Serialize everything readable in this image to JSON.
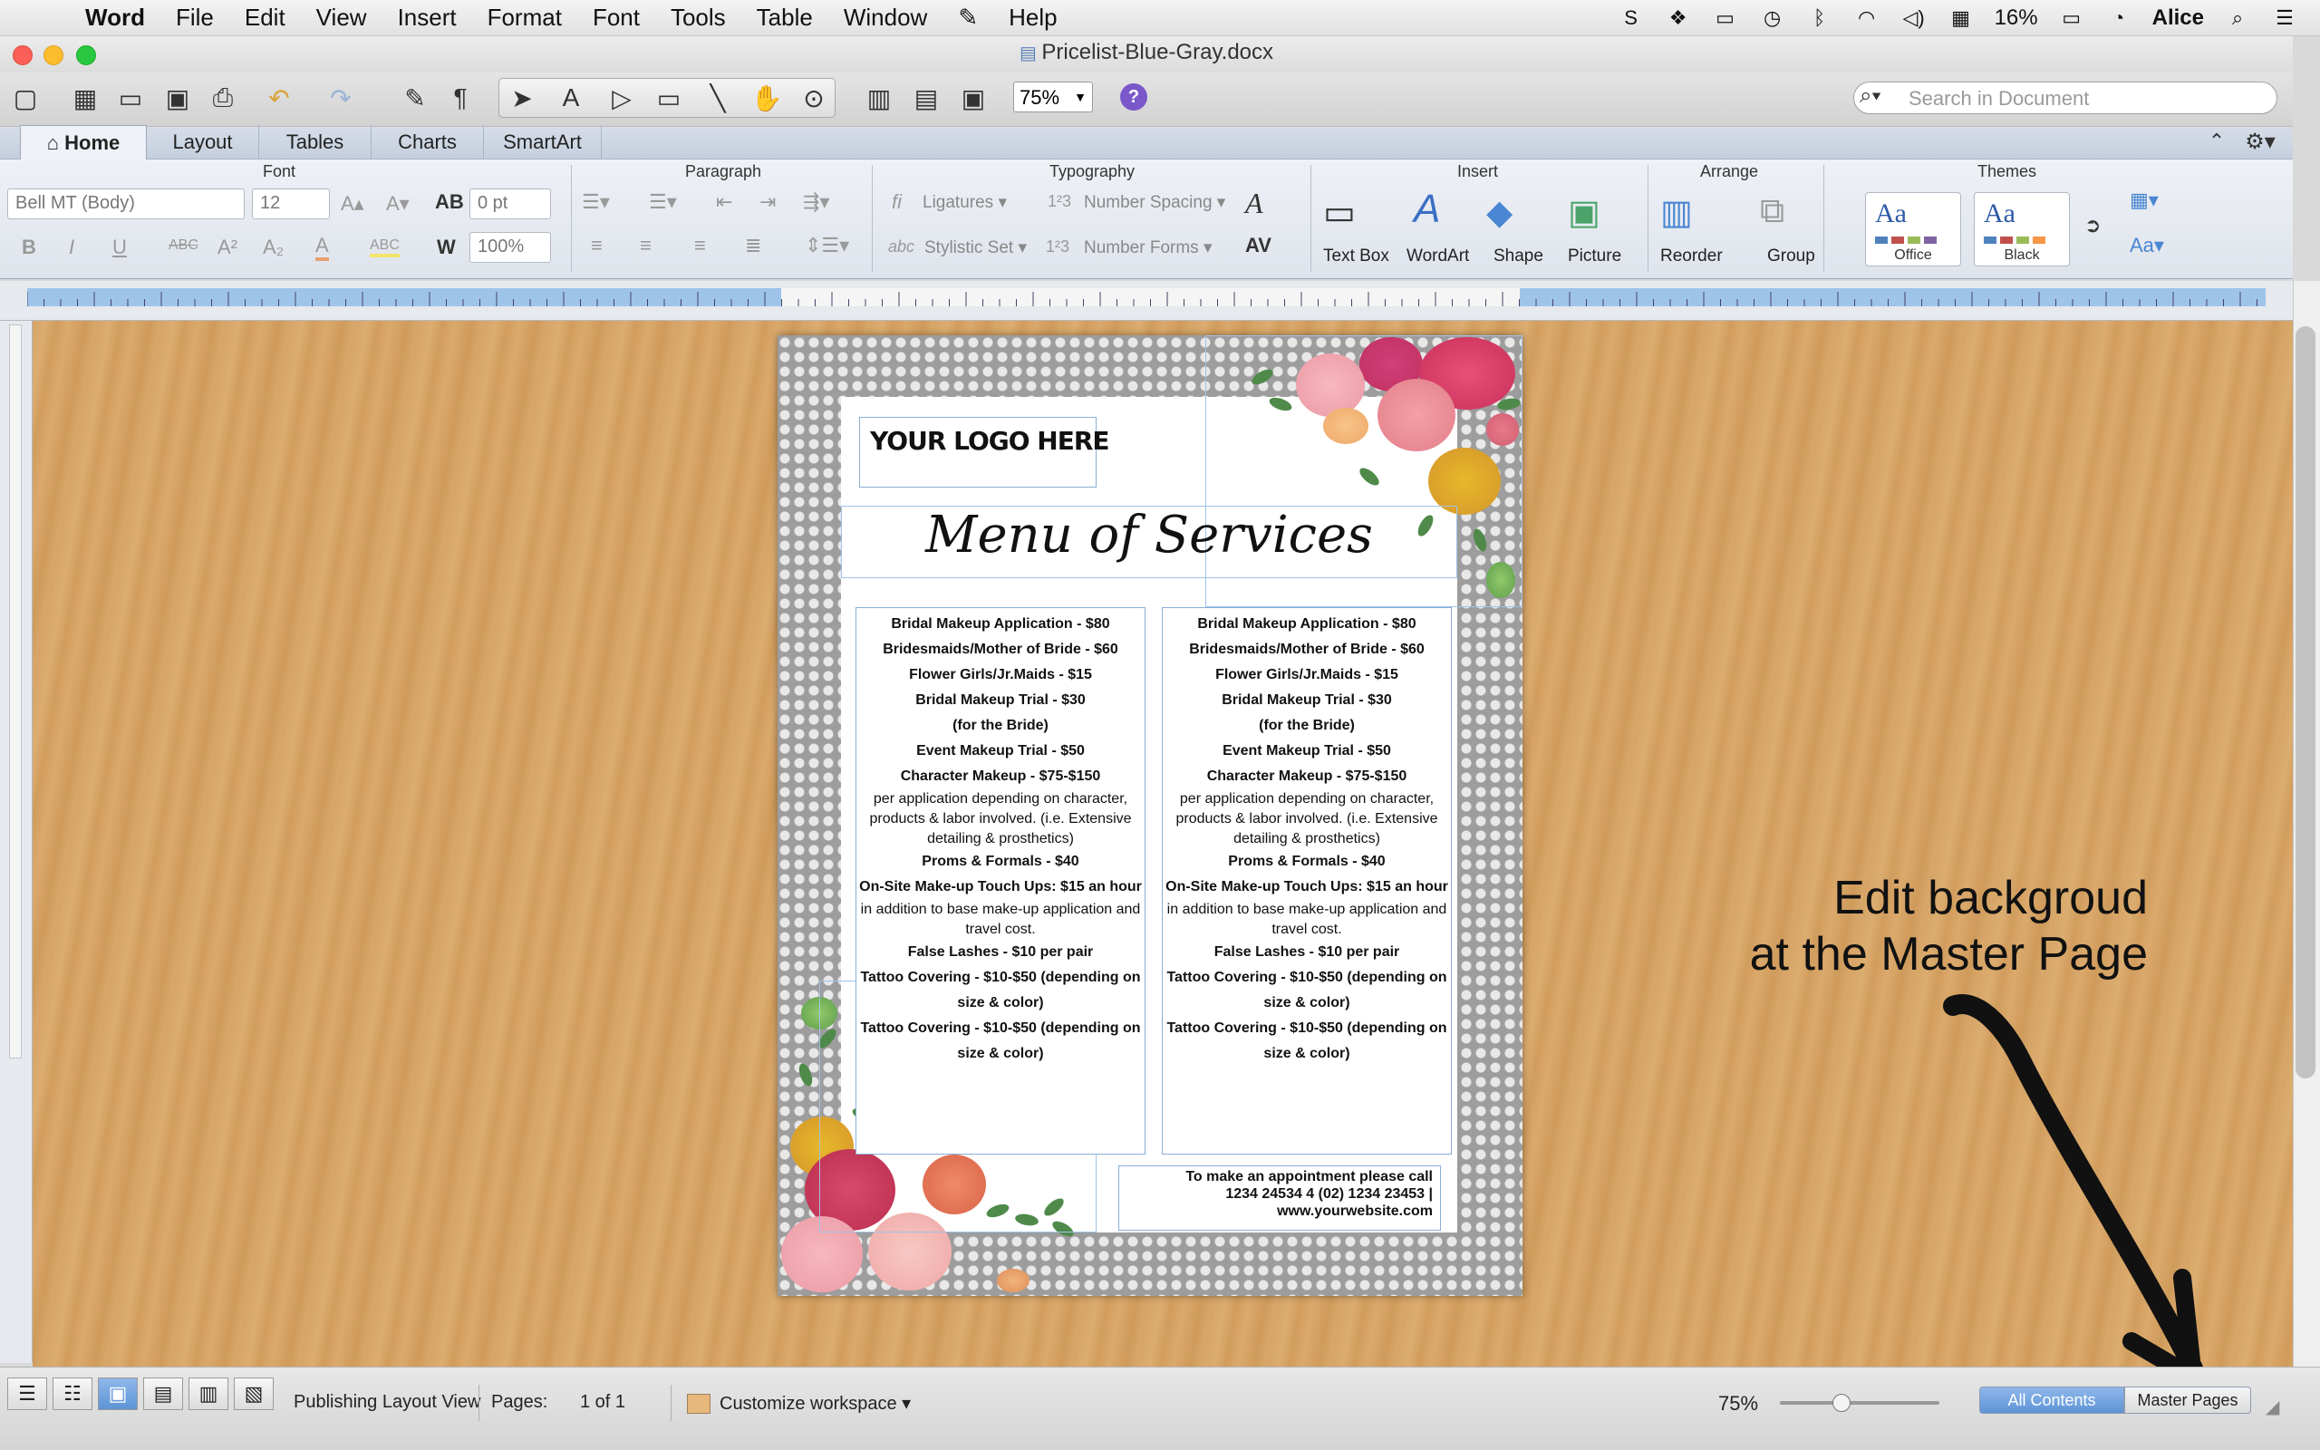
{
  "menubar": {
    "app": "Word",
    "items": [
      "File",
      "Edit",
      "View",
      "Insert",
      "Format",
      "Font",
      "Tools",
      "Table",
      "Window",
      "Help"
    ],
    "battery": "16%",
    "user": "Alice"
  },
  "window": {
    "title": "Pricelist-Blue-Gray.docx"
  },
  "toolbar": {
    "zoom": "75%",
    "search_placeholder": "Search in Document"
  },
  "ribbon_tabs": [
    "Home",
    "Layout",
    "Tables",
    "Charts",
    "SmartArt"
  ],
  "ribbon": {
    "groups": {
      "font": "Font",
      "paragraph": "Paragraph",
      "typography": "Typography",
      "insert": "Insert",
      "arrange": "Arrange",
      "themes": "Themes"
    },
    "font_name": "Bell MT (Body)",
    "font_size": "12",
    "spacing": "0 pt",
    "scale": "100%",
    "ligatures": "Ligatures",
    "number_spacing": "Number Spacing",
    "stylistic_set": "Stylistic Set",
    "number_forms": "Number Forms",
    "insert_buttons": [
      "Text Box",
      "WordArt",
      "Shape",
      "Picture"
    ],
    "arrange_buttons": [
      "Reorder",
      "Group"
    ],
    "themes": [
      "Office",
      "Black"
    ]
  },
  "document": {
    "logo": "YOUR LOGO HERE",
    "title": "Menu of Services",
    "column": [
      {
        "t": "Bridal Makeup Application - $80",
        "b": true
      },
      {
        "t": "Bridesmaids/Mother of Bride - $60",
        "b": true
      },
      {
        "t": "Flower Girls/Jr.Maids - $15",
        "b": true
      },
      {
        "t": "Bridal Makeup Trial - $30",
        "b": true
      },
      {
        "t": "(for the Bride)",
        "b": true
      },
      {
        "t": "Event Makeup Trial - $50",
        "b": true
      },
      {
        "t": "Character Makeup - $75-$150",
        "b": true
      },
      {
        "t": "per application depending on character, products & labor involved. (i.e. Extensive detailing & prosthetics)",
        "b": false
      },
      {
        "t": "Proms & Formals - $40",
        "b": true
      },
      {
        "t": "On-Site Make-up Touch Ups: $15 an hour",
        "b": true
      },
      {
        "t": "in addition to base make-up application and travel cost.",
        "b": false
      },
      {
        "t": "False Lashes - $10 per pair",
        "b": true
      },
      {
        "t": "Tattoo Covering - $10-$50 (depending on size & color)",
        "b": true
      },
      {
        "t": "Tattoo Covering - $10-$50 (depending on size & color)",
        "b": true
      }
    ],
    "contact": [
      "To make an appointment please call",
      "1234 24534 4 (02) 1234 23453 |",
      "www.yourwebsite.com"
    ]
  },
  "annotation": {
    "line1": "Edit backgroud",
    "line2": "at the Master Page"
  },
  "statusbar": {
    "view": "Publishing Layout View",
    "pages_label": "Pages:",
    "pages_value": "1 of 1",
    "workspace": "Customize workspace",
    "zoom": "75%",
    "all_contents": "All Contents",
    "master_pages": "Master Pages"
  },
  "colors": {
    "wood": "#d6a466",
    "accent": "#5d93d6",
    "help": "#7a58c9"
  }
}
